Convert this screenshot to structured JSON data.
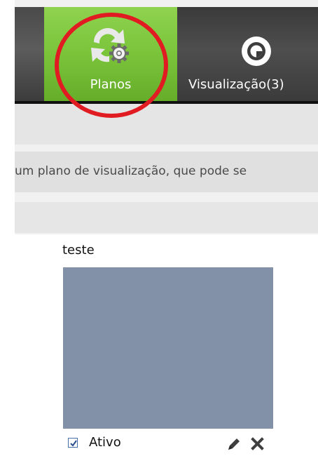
{
  "toolbar": {
    "tabs": [
      {
        "label": "Planos",
        "icon": "plans-refresh-gear-icon",
        "active": true
      },
      {
        "label": "Visualização(3)",
        "icon": "eye-icon",
        "active": false
      }
    ],
    "active_color": "#7ac43a"
  },
  "info": {
    "text": "um plano de visualização, que pode se"
  },
  "card": {
    "title": "teste",
    "thumbnail_color": "#8290a8",
    "active_label": "Ativo",
    "active_checked": true
  },
  "annotation": {
    "color": "#e11b22"
  }
}
